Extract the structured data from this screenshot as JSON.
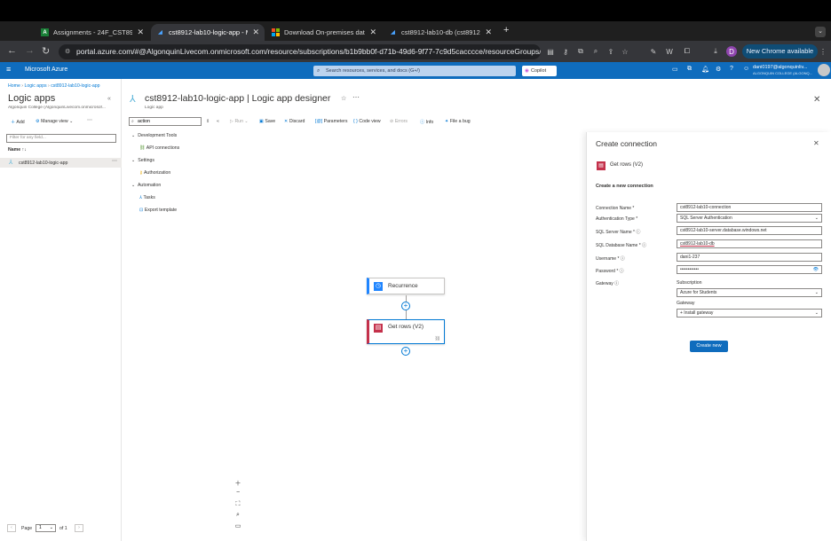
{
  "browser": {
    "tabs": [
      {
        "title": "Assignments - 24F_CST8912",
        "icon": "algonquin-icon",
        "active": false
      },
      {
        "title": "cst8912-lab10-logic-app - M",
        "icon": "azure-icon",
        "active": true
      },
      {
        "title": "Download On-premises data",
        "icon": "microsoft-icon",
        "active": false
      },
      {
        "title": "cst8912-lab10-db (cst8912-",
        "icon": "azure-icon",
        "active": false
      }
    ],
    "new_tab": "+",
    "url": "portal.azure.com/#@AlgonquinLivecom.onmicrosoft.com/resource/subscriptions/b1b9bb0f-d71b-49d6-9f77-7c9d5cacccce/resourceGroups/c...",
    "profile_initial": "D",
    "update_button": "New Chrome available"
  },
  "azure_header": {
    "brand": "Microsoft Azure",
    "search_placeholder": "Search resources, services, and docs (G+/)",
    "copilot": "Copilot",
    "user_email": "dani0197@algonquinliv...",
    "user_org": "ALGONQUIN COLLEGE (ALGONQ..."
  },
  "breadcrumb": [
    "Home",
    "Logic apps",
    "cst8912-lab10-logic-app"
  ],
  "sidebar": {
    "title": "Logic apps",
    "subtitle": "Algonquin College (AlgonquinLivecom.onmicrosof...",
    "add": "Add",
    "manage_view": "Manage view",
    "filter_placeholder": "Filter for any field...",
    "column_header": "Name",
    "items": [
      "cst8912-lab10-logic-app"
    ],
    "pager_label": "Page",
    "pager_value": "1",
    "pager_of": "of 1"
  },
  "designer": {
    "title": "cst8912-lab10-logic-app | Logic app designer",
    "subtitle": "Logic app",
    "search_value": "action",
    "toolbar": {
      "run": "Run",
      "save": "Save",
      "discard": "Discard",
      "parameters": "Parameters",
      "code_view": "Code view",
      "errors": "Errors",
      "info": "Info",
      "file_bug": "File a bug"
    },
    "menu": [
      {
        "group": "Development Tools",
        "items": [
          "API connections"
        ]
      },
      {
        "group": "Settings",
        "items": [
          "Authorization"
        ]
      },
      {
        "group": "Automation",
        "items": [
          "Tasks",
          "Export template"
        ]
      }
    ],
    "nodes": {
      "trigger": "Recurrence",
      "action": "Get rows (V2)"
    }
  },
  "panel": {
    "title": "Create connection",
    "action_name": "Get rows (V2)",
    "section": "Create a new connection",
    "fields": [
      {
        "label": "Connection Name *",
        "value": "cst8912-lab10-connection"
      },
      {
        "label": "Authentication Type *",
        "value": "SQL Server Authentication"
      },
      {
        "label": "SQL Server Name * ⓘ",
        "value": "cst8912-lab10-server.database.windows.net"
      },
      {
        "label": "SQL Database Name * ⓘ",
        "value": "cst8912-lab10-db"
      },
      {
        "label": "Username * ⓘ",
        "value": "dani1-237"
      },
      {
        "label": "Password * ⓘ",
        "value": "••••••••••••"
      }
    ],
    "gateway_label": "Gateway ⓘ",
    "subscription_label": "Subscription",
    "subscription_value": "Azure for Students",
    "gateway_sub_label": "Gateway",
    "gateway_value": "+ Install gateway",
    "create_button": "Create new"
  },
  "colors": {
    "azure_blue": "#0f6cbd",
    "primary_button": "#0f6cbd",
    "connector_red": "#c4314b",
    "recurrence_blue": "#1f85ff"
  }
}
